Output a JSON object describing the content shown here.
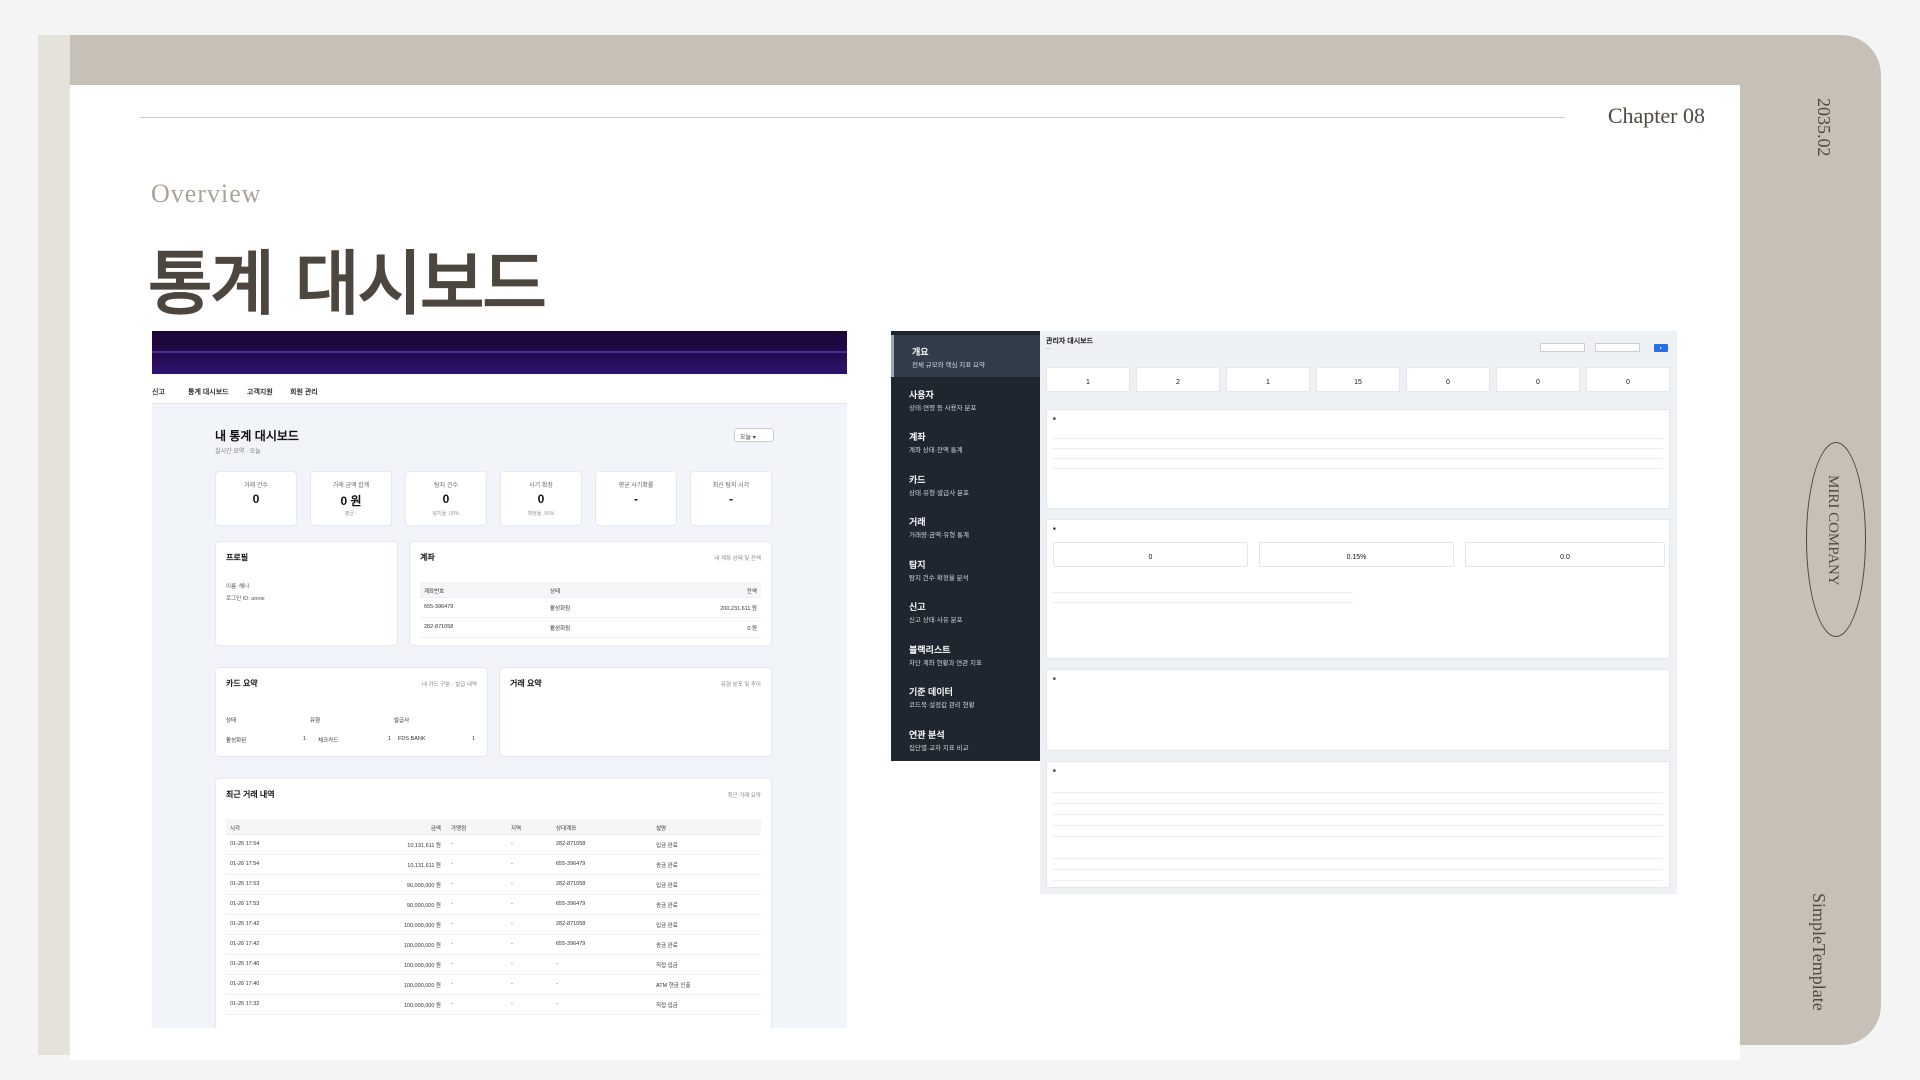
{
  "slide": {
    "chapter": "Chapter 08",
    "overview": "Overview",
    "title": "통계 대시보드",
    "date": "2035.02",
    "company": "MIRI COMPANY",
    "template": "SimpleTemplate"
  },
  "left_shot": {
    "nav": [
      "신고",
      "통계 대시보드",
      "고객지원",
      "회원 관리"
    ],
    "page_title": "내 통계 대시보드",
    "page_subtitle": "실시간 요약 · 오늘",
    "period": "오늘",
    "kpis": [
      {
        "label": "거래 건수",
        "value": "0",
        "sub": ""
      },
      {
        "label": "거래 금액 합계",
        "value": "0 원",
        "sub": "평균 -"
      },
      {
        "label": "탐지 건수",
        "value": "0",
        "sub": "탐지율 .00%"
      },
      {
        "label": "사기 확정",
        "value": "0",
        "sub": "확정율 .00%"
      },
      {
        "label": "평균 사기확률",
        "value": "-",
        "sub": ""
      },
      {
        "label": "최신 탐지 시각",
        "value": "-",
        "sub": ""
      }
    ],
    "profile": {
      "title": "프로필",
      "name": "이름: 해나",
      "login": "로그인 ID: annie"
    },
    "accounts": {
      "title": "계좌",
      "note": "내 계좌 상태 및 잔액",
      "headers": [
        "계좌번호",
        "상태",
        "잔액"
      ],
      "rows": [
        [
          "655-396479",
          "활성화됨",
          "200,231,611 원"
        ],
        [
          "282-871058",
          "활성화됨",
          "0 원"
        ]
      ]
    },
    "cards": {
      "title": "카드 요약",
      "note": "내 카드 구분 · 발급 내역",
      "headers": [
        "상태",
        "유형",
        "발급사"
      ],
      "row": [
        "활성화된",
        "1",
        "체크카드",
        "1",
        "FDS BANK",
        "1"
      ]
    },
    "tx_summary": {
      "title": "거래 요약",
      "note": "유형 분포 및 추이"
    },
    "recent": {
      "title": "최근 거래 내역",
      "note": "최근 거래 요약",
      "headers": [
        "시각",
        "금액",
        "가맹점",
        "지역",
        "상대계좌",
        "설명"
      ],
      "rows": [
        [
          "01-26 17:54",
          "10,131,611 원",
          "-",
          "-",
          "282-871058",
          "입금 완료"
        ],
        [
          "01-26 17:54",
          "10,131,611 원",
          "-",
          "-",
          "655-396479",
          "송금 완료"
        ],
        [
          "01-26 17:53",
          "90,000,000 원",
          "-",
          "-",
          "282-871058",
          "입금 완료"
        ],
        [
          "01-26 17:53",
          "90,000,000 원",
          "-",
          "-",
          "655-396479",
          "송금 완료"
        ],
        [
          "01-26 17:42",
          "100,000,000 원",
          "-",
          "-",
          "282-871058",
          "입금 완료"
        ],
        [
          "01-26 17:42",
          "100,000,000 원",
          "-",
          "-",
          "655-396479",
          "송금 완료"
        ],
        [
          "01-26 17:40",
          "100,000,000 원",
          "-",
          "-",
          "-",
          "직접 입금"
        ],
        [
          "01-26 17:40",
          "100,000,000 원",
          "-",
          "-",
          "-",
          "ATM 현금 인출"
        ],
        [
          "01-26 17:32",
          "100,000,000 원",
          "-",
          "-",
          "-",
          "직접 입금"
        ]
      ]
    }
  },
  "right_shot": {
    "sidebar": [
      {
        "title": "개요",
        "desc": "전체 규모와 핵심 지표 요약",
        "active": true
      },
      {
        "title": "사용자",
        "desc": "상태·연령 등 사용자 분포",
        "active": false
      },
      {
        "title": "계좌",
        "desc": "계좌 상태·잔액 통계",
        "active": false
      },
      {
        "title": "카드",
        "desc": "상태·유형·발급사 분포",
        "active": false
      },
      {
        "title": "거래",
        "desc": "거래량·금액·유형 통계",
        "active": false
      },
      {
        "title": "탐지",
        "desc": "탐지 건수·확정율 분석",
        "active": false
      },
      {
        "title": "신고",
        "desc": "신고 상태·사유 분포",
        "active": false
      },
      {
        "title": "블랙리스트",
        "desc": "차단 계좌 현황과 연관 지표",
        "active": false
      },
      {
        "title": "기준 데이터",
        "desc": "코드북·설정값 관리 현황",
        "active": false
      },
      {
        "title": "연관 분석",
        "desc": "집단별·교차 지표 비교",
        "active": false
      }
    ],
    "title": "관리자 대시보드",
    "kpi_values": [
      "1",
      "2",
      "1",
      "15",
      "0",
      "0",
      "0"
    ],
    "section_kpis": [
      "0",
      "0.15%",
      "0.0"
    ]
  }
}
